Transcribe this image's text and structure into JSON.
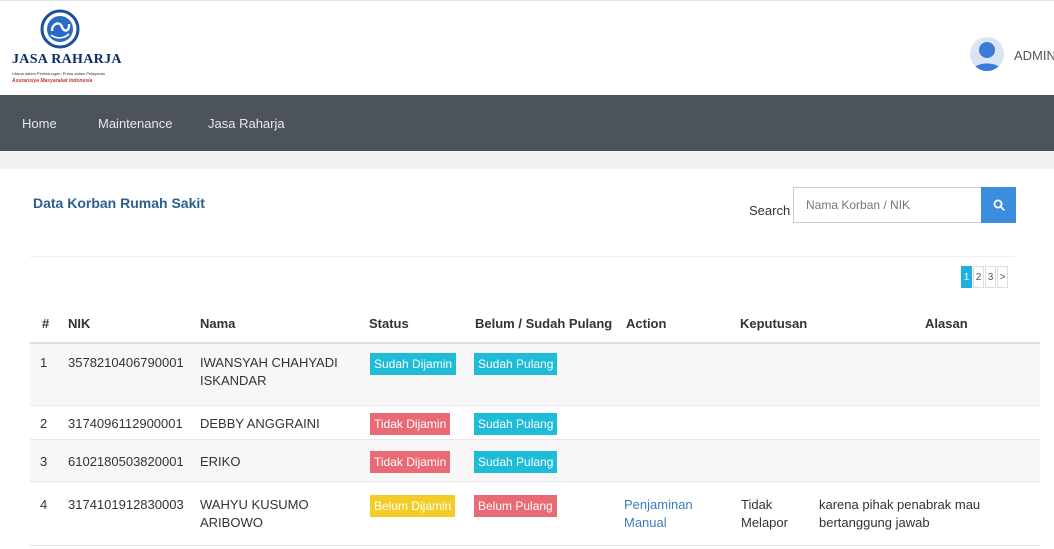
{
  "brand": {
    "name": "JASA RAHARJA",
    "tagline_line1": "Utama dalam Perlindungan, Prima dalam Pelayanan",
    "tagline_line2": "Asuransiya Masyarakat Indonesia"
  },
  "user": {
    "name": "ADMIN"
  },
  "nav": {
    "items": [
      "Home",
      "Maintenance",
      "Jasa Raharja"
    ]
  },
  "panel": {
    "title": "Data Korban Rumah Sakit"
  },
  "search": {
    "label": "Search",
    "placeholder": "Nama Korban / NIK"
  },
  "pagination": {
    "pages": [
      "1",
      "2",
      "3",
      ">"
    ],
    "current": "1"
  },
  "table": {
    "headers": [
      "#",
      "NIK",
      "Nama",
      "Status",
      "Belum / Sudah Pulang",
      "Action",
      "Keputusan",
      "Alasan"
    ],
    "rows": [
      {
        "no": "1",
        "nik": "3578210406790001",
        "nama": "IWANSYAH CHAHYADI ISKANDAR",
        "status": "Sudah Dijamin",
        "status_color": "#1ebcd6",
        "pulang": "Sudah Pulang",
        "pulang_color": "#1ebcd6",
        "action": "",
        "keputusan": "",
        "alasan": ""
      },
      {
        "no": "2",
        "nik": "3174096112900001",
        "nama": "DEBBY ANGGRAINI",
        "status": "Tidak Dijamin",
        "status_color": "#e86a74",
        "pulang": "Sudah Pulang",
        "pulang_color": "#1ebcd6",
        "action": "",
        "keputusan": "",
        "alasan": ""
      },
      {
        "no": "3",
        "nik": "6102180503820001",
        "nama": "ERIKO",
        "status": "Tidak Dijamin",
        "status_color": "#e86a74",
        "pulang": "Sudah Pulang",
        "pulang_color": "#1ebcd6",
        "action": "",
        "keputusan": "",
        "alasan": ""
      },
      {
        "no": "4",
        "nik": "3174101912830003",
        "nama": "WAHYU KUSUMO ARIBOWO",
        "status": "Belum Dijamin",
        "status_color": "#f3cd26",
        "pulang": "Belum Pulang",
        "pulang_color": "#e86a74",
        "action": "Penjaminan Manual",
        "keputusan": "Tidak Melapor",
        "alasan": "karena pihak penabrak mau bertanggung jawab"
      }
    ]
  },
  "colors": {
    "navbar": "#4c535a",
    "title_blue": "#2a5f93",
    "accent": "#3c8dde"
  }
}
